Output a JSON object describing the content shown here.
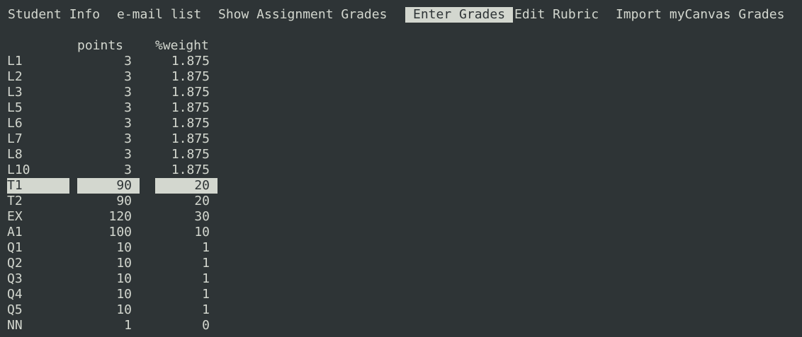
{
  "menu": [
    {
      "label": "Student Info",
      "active": false
    },
    {
      "label": "e-mail list",
      "active": false
    },
    {
      "label": "Show Assignment Grades",
      "active": false
    },
    {
      "label": "Enter Grades",
      "active": true
    },
    {
      "label": "Edit Rubric",
      "active": false
    },
    {
      "label": "Import myCanvas Grades",
      "active": false
    }
  ],
  "table": {
    "headers": {
      "points": "points",
      "weight": "%weight"
    },
    "rows": [
      {
        "name": "L1",
        "points": "3",
        "weight": "1.875"
      },
      {
        "name": "L2",
        "points": "3",
        "weight": "1.875"
      },
      {
        "name": "L3",
        "points": "3",
        "weight": "1.875"
      },
      {
        "name": "L5",
        "points": "3",
        "weight": "1.875"
      },
      {
        "name": "L6",
        "points": "3",
        "weight": "1.875"
      },
      {
        "name": "L7",
        "points": "3",
        "weight": "1.875"
      },
      {
        "name": "L8",
        "points": "3",
        "weight": "1.875"
      },
      {
        "name": "L10",
        "points": "3",
        "weight": "1.875"
      },
      {
        "name": "T1",
        "points": "90",
        "weight": "20"
      },
      {
        "name": "T2",
        "points": "90",
        "weight": "20"
      },
      {
        "name": "EX",
        "points": "120",
        "weight": "30"
      },
      {
        "name": "A1",
        "points": "100",
        "weight": "10"
      },
      {
        "name": "Q1",
        "points": "10",
        "weight": "1"
      },
      {
        "name": "Q2",
        "points": "10",
        "weight": "1"
      },
      {
        "name": "Q3",
        "points": "10",
        "weight": "1"
      },
      {
        "name": "Q4",
        "points": "10",
        "weight": "1"
      },
      {
        "name": "Q5",
        "points": "10",
        "weight": "1"
      },
      {
        "name": "NN",
        "points": "1",
        "weight": "0"
      }
    ],
    "selected_row": "T1"
  },
  "colors": {
    "background": "#2e3436",
    "foreground": "#d3d7cf",
    "highlight_bg": "#d3d7cf",
    "highlight_fg": "#2e3436"
  }
}
